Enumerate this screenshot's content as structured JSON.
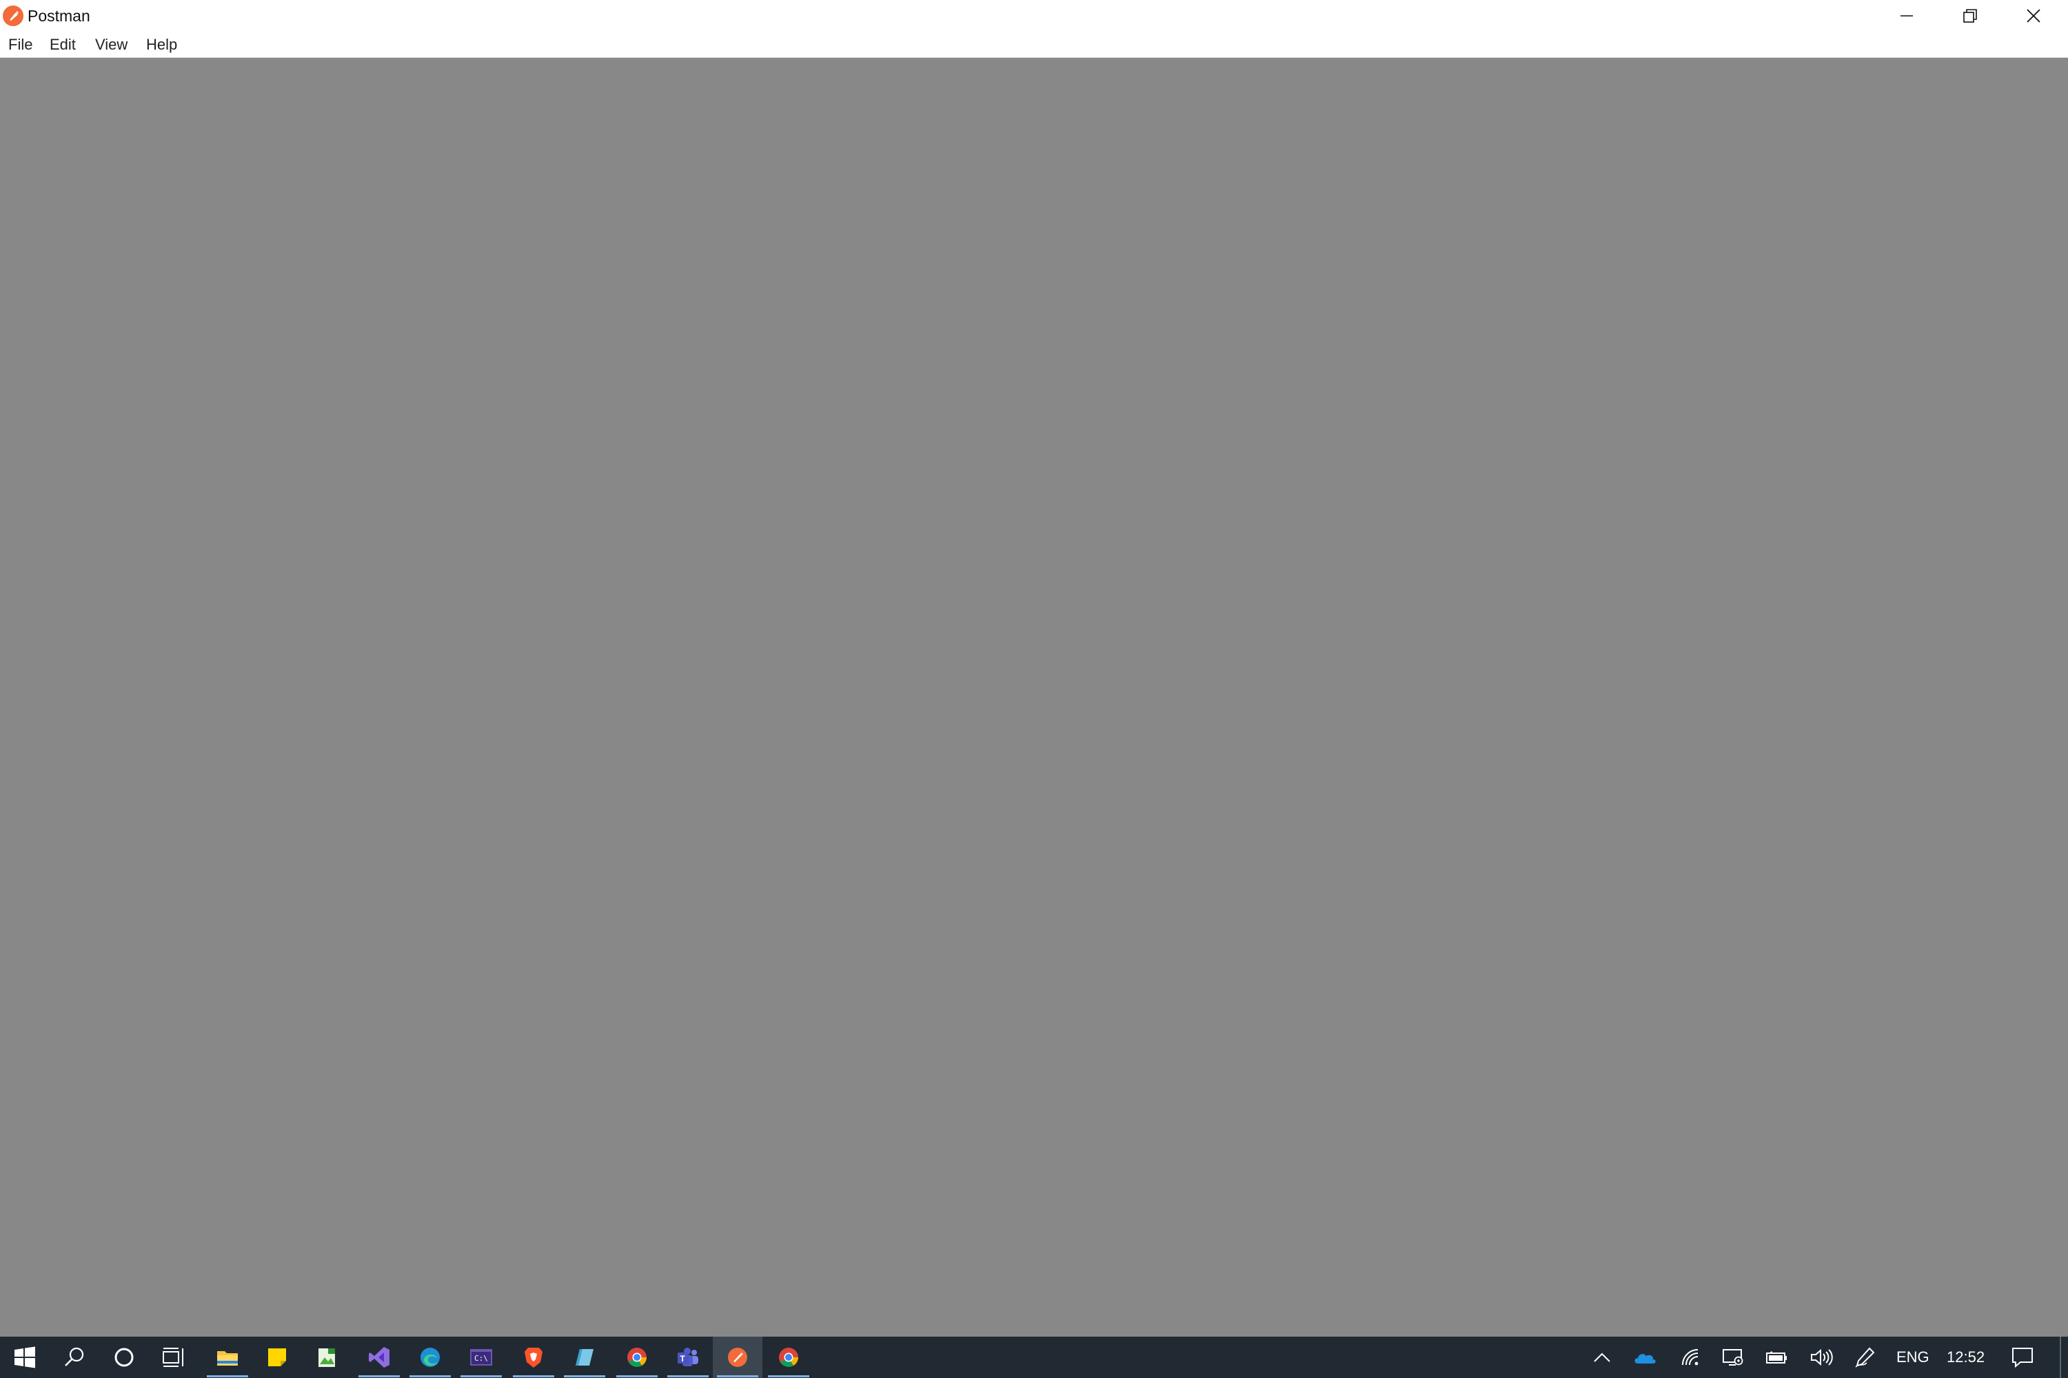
{
  "window": {
    "title": "Postman",
    "logo_icon": "postman-logo-icon",
    "controls": [
      "minimize-icon",
      "restore-icon",
      "close-icon"
    ]
  },
  "menu": {
    "items": [
      "File",
      "Edit",
      "View",
      "Help"
    ]
  },
  "content": {
    "background": "#888888"
  },
  "taskbar": {
    "start_icon": "windows-start-icon",
    "search_icon": "search-icon",
    "cortana_icon": "cortana-icon",
    "taskview_icon": "task-view-icon",
    "apps": [
      {
        "name": "file-explorer-icon",
        "running": true
      },
      {
        "name": "sticky-notes-icon",
        "running": false
      },
      {
        "name": "photo-editor-icon",
        "running": false
      },
      {
        "name": "visual-studio-icon",
        "running": true
      },
      {
        "name": "edge-icon",
        "running": true
      },
      {
        "name": "terminal-icon",
        "running": true
      },
      {
        "name": "brave-icon",
        "running": true
      },
      {
        "name": "paint-3d-icon",
        "running": true
      },
      {
        "name": "chrome-icon",
        "running": true
      },
      {
        "name": "teams-icon",
        "running": true
      },
      {
        "name": "postman-icon",
        "running": true,
        "active": true
      },
      {
        "name": "chrome-icon",
        "running": true
      }
    ],
    "tray": {
      "overflow_icon": "chevron-up-icon",
      "icons": [
        "onedrive-icon",
        "wifi-icon",
        "remote-desktop-icon",
        "battery-icon",
        "volume-icon",
        "pen-icon"
      ],
      "language": "ENG",
      "time": "12:52",
      "notification_icon": "notification-icon"
    }
  },
  "colors": {
    "titlebar": "#ffffff",
    "content": "#888888",
    "taskbar": "#212a33",
    "postman_orange": "#f26b3a",
    "running_indicator": "#7fb2e5"
  }
}
